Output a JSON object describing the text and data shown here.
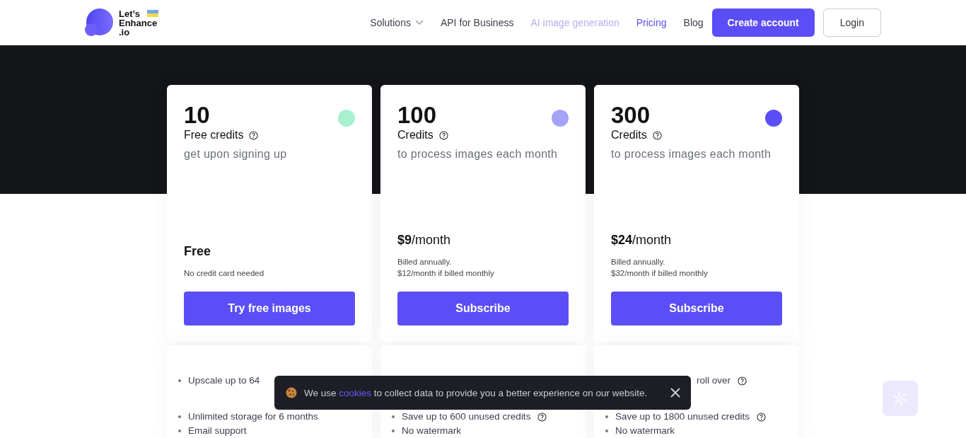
{
  "header": {
    "logo": {
      "line1": "Let’s",
      "line2": "Enhance",
      "line3": ".io"
    },
    "nav": [
      {
        "label": "Solutions",
        "kind": "dropdown",
        "selected": false,
        "muted": false
      },
      {
        "label": "API for Business",
        "kind": "link",
        "selected": false,
        "muted": false
      },
      {
        "label": "AI image generation",
        "kind": "link",
        "selected": false,
        "muted": true
      },
      {
        "label": "Pricing",
        "kind": "link",
        "selected": true,
        "muted": false
      },
      {
        "label": "Blog",
        "kind": "link",
        "selected": false,
        "muted": false
      }
    ],
    "primary_button": "Create account",
    "secondary_button": "Login"
  },
  "plans": [
    {
      "amount": "10",
      "unit": "Free credits",
      "description": "get upon signing up",
      "color": "#a8f0d0",
      "price": "Free",
      "notes": [
        "No credit card needed"
      ],
      "button": "Try free images",
      "features": [
        {
          "text": "Upscale up to 64",
          "help": false,
          "cut": false
        },
        {
          "text": "Unlimited storage for 6 months",
          "help": false,
          "cut": false
        },
        {
          "text": "Email support",
          "help": false,
          "cut": false
        }
      ]
    },
    {
      "amount": "100",
      "unit": "Credits",
      "description": "to process images each month",
      "color": "#a5a3f7",
      "price": "$9",
      "period": "/month",
      "notes": [
        "Billed annually.",
        "$12/month if billed monthly"
      ],
      "button": "Subscribe",
      "features": [
        {
          "text": "Save up to 600 unused credits",
          "help": true,
          "cut": false
        },
        {
          "text": "No watermark",
          "help": false,
          "cut": false
        }
      ]
    },
    {
      "amount": "300",
      "unit": "Credits",
      "description": "to process images each month",
      "color": "#5b4ef6",
      "price": "$24",
      "period": "/month",
      "notes": [
        "Billed annually.",
        "$32/month if billed monthly"
      ],
      "button": "Subscribe",
      "features": [
        {
          "text": "roll over",
          "help": true,
          "cut": true
        },
        {
          "text": "Save up to 1800 unused credits",
          "help": true,
          "cut": false
        },
        {
          "text": "No watermark",
          "help": false,
          "cut": false
        }
      ]
    }
  ],
  "cookie_banner": {
    "before": "We use",
    "link": "cookies",
    "after": "to collect data to provide you a better experience on our website."
  }
}
